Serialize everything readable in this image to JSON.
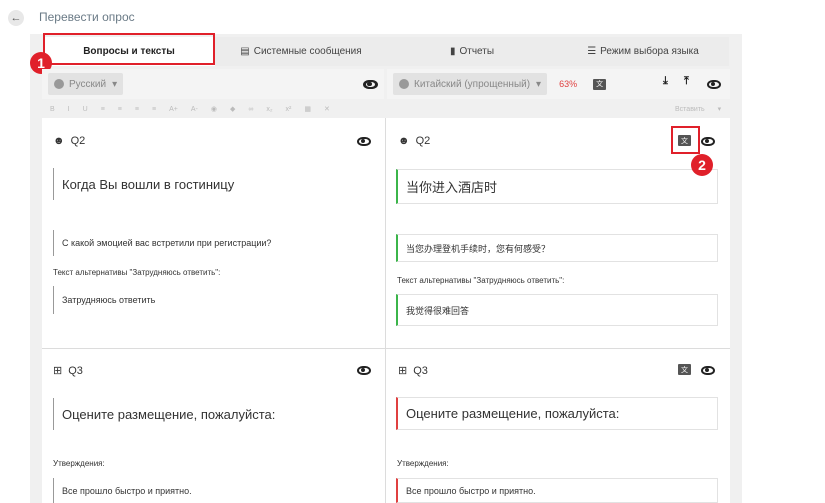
{
  "header": {
    "title": "Перевести опрос"
  },
  "tabs": [
    {
      "label": "Вопросы и тексты",
      "icon": ""
    },
    {
      "label": "Системные сообщения",
      "icon": "message-icon"
    },
    {
      "label": "Отчеты",
      "icon": "bar-chart-icon"
    },
    {
      "label": "Режим выбора языка",
      "icon": "list-icon"
    }
  ],
  "annotations": {
    "badge1": "1",
    "badge2": "2"
  },
  "source_lang": {
    "label": "Русский"
  },
  "target_lang": {
    "label": "Китайский (упрощенный)",
    "percent": "63%"
  },
  "format_toolbar": {
    "insert_label": "Вставить"
  },
  "questions": {
    "q2": {
      "id": "Q2",
      "source": {
        "title": "Когда Вы вошли в гостиницу",
        "subtitle": "С какой эмоцией вас встретили при регистрации?",
        "alt_label": "Текст альтернативы \"Затрудняюсь ответить\":",
        "alt_text": "Затрудняюсь ответить"
      },
      "target": {
        "title": "当你进入酒店时",
        "subtitle": "当您办理登机手续时，您有何感受？",
        "alt_label": "Текст альтернативы \"Затрудняюсь ответить\":",
        "alt_text": "我觉得很难回答"
      }
    },
    "q3": {
      "id": "Q3",
      "source": {
        "title": "Оцените размещение, пожалуйста:",
        "statements_label": "Утверждения:",
        "statement1": "Все прошло быстро и приятно."
      },
      "target": {
        "title": "Оцените размещение, пожалуйста:",
        "statements_label": "Утверждения:",
        "statement1": "Все прошло быстро и приятно."
      }
    }
  },
  "colors": {
    "accent_red": "#e0202a",
    "translated": "#3bb54a",
    "untranslated": "#e04040"
  }
}
